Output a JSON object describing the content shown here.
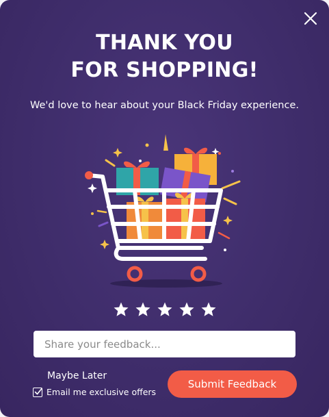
{
  "modal": {
    "title_line1": "THANK YOU",
    "title_line2": "FOR SHOPPING!",
    "subtitle": "We'd love to hear about your Black Friday experience."
  },
  "rating": {
    "max": 5,
    "icon": "star-icon",
    "color": "#ffffff"
  },
  "feedback": {
    "placeholder": "Share your feedback...",
    "value": ""
  },
  "actions": {
    "maybe_later": "Maybe Later",
    "submit": "Submit Feedback",
    "email_opt_in": "Email me exclusive offers",
    "email_opt_in_checked": true
  },
  "icons": {
    "close": "close-icon",
    "illustration": "shopping-cart-gifts-icon",
    "checkbox": "checkmark-icon"
  },
  "colors": {
    "background": "#3f2d6b",
    "accent": "#f25c47",
    "text": "#ffffff"
  }
}
